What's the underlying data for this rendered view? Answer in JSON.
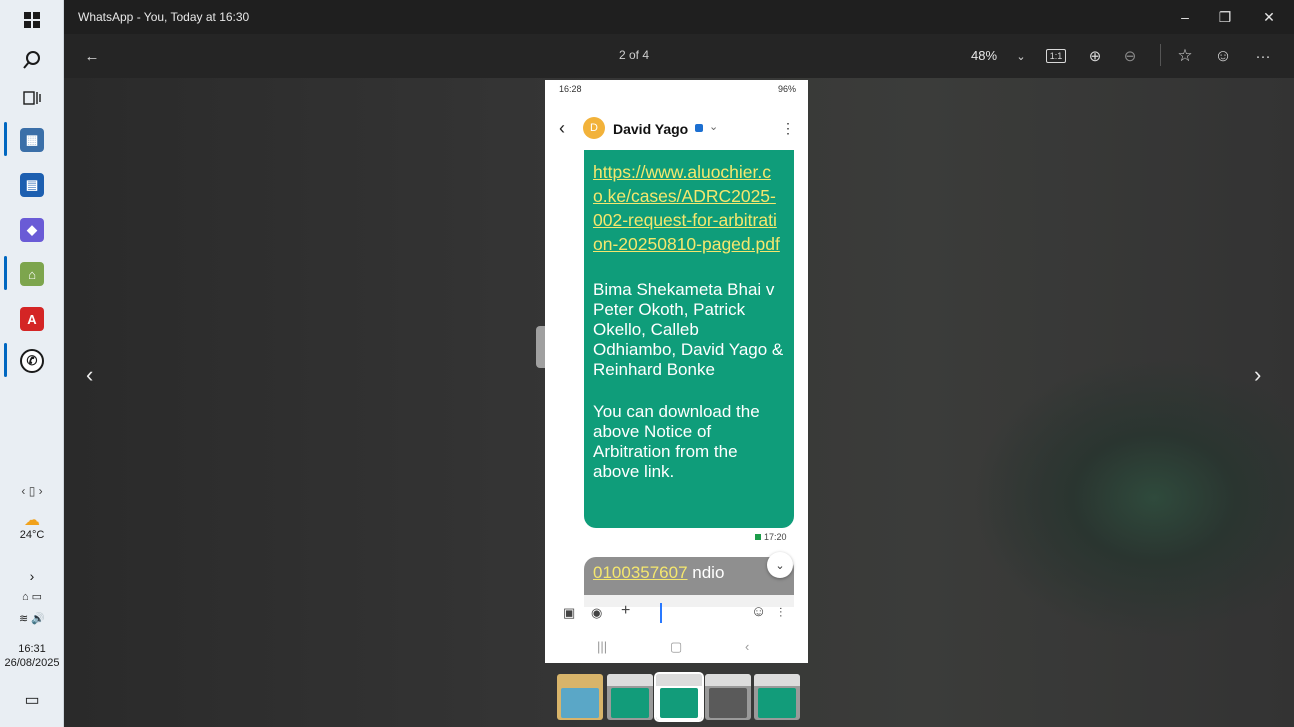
{
  "taskbar": {
    "weather": "24°C",
    "time": "16:31",
    "date": "26/08/2025"
  },
  "window": {
    "title": "WhatsApp - You, Today at 16:30",
    "counter": "2 of 4",
    "zoom": "48%",
    "fit_label": "1:1"
  },
  "phone": {
    "status_time": "16:28",
    "battery": "96%",
    "contact": "David Yago",
    "avatar_letter": "D",
    "link": "https://www.aluochier.co.ke/cases/ADRC2025-002-request-for-arbitration-20250810-paged.pdf",
    "message_1": "Bima Shekameta Bhai v Peter Okoth, Patrick Okello, Calleb Odhiambo, David Yago & Reinhard Bonke",
    "message_2": "You can download the above Notice of Arbitration from the above link.",
    "message_time": "17:20",
    "next_number": "0100357607",
    "next_text": " ndio"
  },
  "colors": {
    "bubble": "#0f9d7a",
    "link": "#f5e76e",
    "accent": "#0067c0"
  }
}
